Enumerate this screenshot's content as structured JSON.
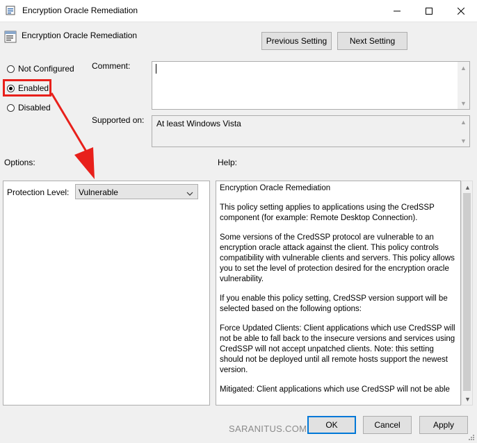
{
  "window": {
    "title": "Encryption Oracle Remediation",
    "controls": {
      "minimize": "minimize-icon",
      "maximize": "maximize-icon",
      "close": "close-icon"
    }
  },
  "header": {
    "policy_name": "Encryption Oracle Remediation",
    "prev_label": "Previous Setting",
    "next_label": "Next Setting"
  },
  "state": {
    "options": [
      {
        "label": "Not Configured",
        "selected": false
      },
      {
        "label": "Enabled",
        "selected": true
      },
      {
        "label": "Disabled",
        "selected": false
      }
    ]
  },
  "comment": {
    "label": "Comment:",
    "value": ""
  },
  "supported": {
    "label": "Supported on:",
    "value": "At least Windows Vista"
  },
  "options_panel": {
    "label": "Options:",
    "protection_label": "Protection Level:",
    "protection_value": "Vulnerable"
  },
  "help": {
    "label": "Help:",
    "paragraphs": [
      "Encryption Oracle Remediation",
      "This policy setting applies to applications using the CredSSP component (for example: Remote Desktop Connection).",
      "Some versions of the CredSSP protocol are vulnerable to an encryption oracle attack against the client.  This policy controls compatibility with vulnerable clients and servers.  This policy allows you to set the level of protection desired for the encryption oracle vulnerability.",
      "If you enable this policy setting, CredSSP version support will be selected based on the following options:",
      "Force Updated Clients: Client applications which use CredSSP will not be able to fall back to the insecure versions and services using CredSSP will not accept unpatched clients. Note: this setting should not be deployed until all remote hosts support the newest version.",
      "Mitigated: Client applications which use CredSSP will not be able"
    ]
  },
  "footer": {
    "watermark": "SARANITUS.COM",
    "ok_label": "OK",
    "cancel_label": "Cancel",
    "apply_label": "Apply"
  },
  "annotation": {
    "color": "#e8201b"
  }
}
